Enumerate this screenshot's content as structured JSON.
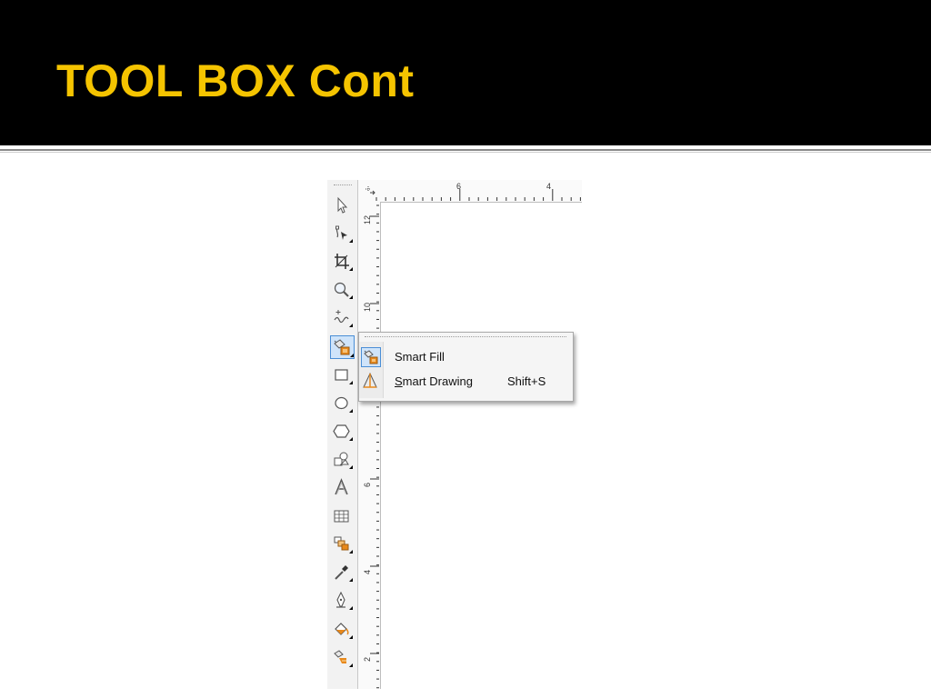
{
  "slide": {
    "title": "TOOL BOX Cont",
    "colors": {
      "background": "#000000",
      "title": "#f5c400",
      "accent_orange": "#e8891c"
    }
  },
  "toolbox": {
    "tools": [
      {
        "name": "pick-tool-icon",
        "has_flyout": false,
        "active": false
      },
      {
        "name": "shape-tool-icon",
        "has_flyout": true,
        "active": false
      },
      {
        "name": "crop-tool-icon",
        "has_flyout": true,
        "active": false
      },
      {
        "name": "zoom-tool-icon",
        "has_flyout": true,
        "active": false
      },
      {
        "name": "freehand-tool-icon",
        "has_flyout": true,
        "active": false
      },
      {
        "name": "smart-fill-tool-icon",
        "has_flyout": true,
        "active": true
      },
      {
        "name": "rectangle-tool-icon",
        "has_flyout": true,
        "active": false
      },
      {
        "name": "ellipse-tool-icon",
        "has_flyout": true,
        "active": false
      },
      {
        "name": "polygon-tool-icon",
        "has_flyout": true,
        "active": false
      },
      {
        "name": "basic-shapes-tool-icon",
        "has_flyout": true,
        "active": false
      },
      {
        "name": "text-tool-icon",
        "has_flyout": false,
        "active": false
      },
      {
        "name": "table-tool-icon",
        "has_flyout": false,
        "active": false
      },
      {
        "name": "blend-tool-icon",
        "has_flyout": true,
        "active": false
      },
      {
        "name": "eyedropper-tool-icon",
        "has_flyout": true,
        "active": false
      },
      {
        "name": "outline-pen-tool-icon",
        "has_flyout": true,
        "active": false
      },
      {
        "name": "fill-tool-icon",
        "has_flyout": true,
        "active": false
      },
      {
        "name": "interactive-fill-tool-icon",
        "has_flyout": true,
        "active": false
      }
    ]
  },
  "rulers": {
    "horizontal_labels": [
      "6",
      "4"
    ],
    "vertical_labels": [
      "12",
      "10",
      "6",
      "4",
      "2"
    ]
  },
  "flyout": {
    "items": [
      {
        "label": "Smart Fill",
        "shortcut": "",
        "icon": "smart-fill-icon",
        "selected": true
      },
      {
        "label": "Smart Drawing",
        "shortcut": "Shift+S",
        "icon": "smart-drawing-icon",
        "selected": false
      }
    ]
  }
}
